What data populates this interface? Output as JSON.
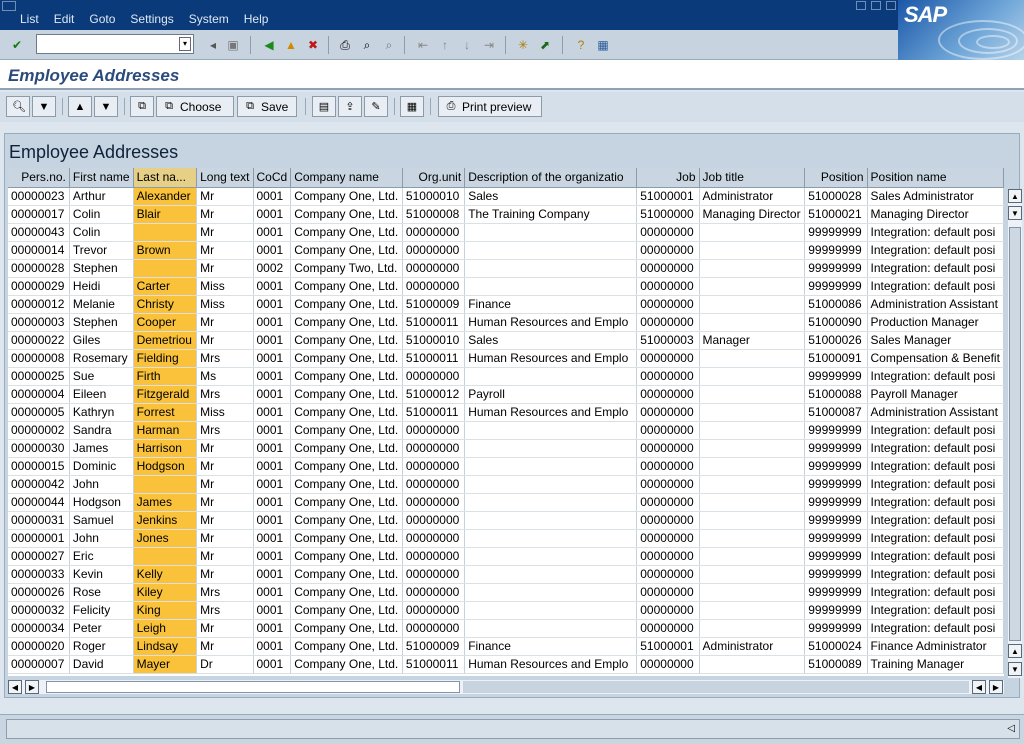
{
  "menu": {
    "items": [
      "List",
      "Edit",
      "Goto",
      "Settings",
      "System",
      "Help"
    ]
  },
  "logo_text": "SAP",
  "page_title": "Employee Addresses",
  "app_toolbar": {
    "choose_label": "Choose",
    "save_label": "Save",
    "print_preview_label": "Print preview"
  },
  "list_title": "Employee Addresses",
  "columns": [
    "Pers.no.",
    "First name",
    "Last na...",
    "Long text",
    "CoCd",
    "Company name",
    "Org.unit",
    "Description of the organizatio",
    "Job",
    "Job title",
    "Position",
    "Position name"
  ],
  "rows": [
    [
      "00000023",
      "Arthur",
      "Alexander",
      "Mr",
      "0001",
      "Company One, Ltd.",
      "51000010",
      "Sales",
      "51000001",
      "Administrator",
      "51000028",
      "Sales Administrator"
    ],
    [
      "00000017",
      "Colin",
      "Blair",
      "Mr",
      "0001",
      "Company One, Ltd.",
      "51000008",
      "The Training Company",
      "51000000",
      "Managing Director",
      "51000021",
      "Managing Director"
    ],
    [
      "00000043",
      "Colin",
      "",
      "Mr",
      "0001",
      "Company One, Ltd.",
      "00000000",
      "",
      "00000000",
      "",
      "99999999",
      "Integration: default posi"
    ],
    [
      "00000014",
      "Trevor",
      "Brown",
      "Mr",
      "0001",
      "Company One, Ltd.",
      "00000000",
      "",
      "00000000",
      "",
      "99999999",
      "Integration: default posi"
    ],
    [
      "00000028",
      "Stephen",
      "",
      "Mr",
      "0002",
      "Company Two, Ltd.",
      "00000000",
      "",
      "00000000",
      "",
      "99999999",
      "Integration: default posi"
    ],
    [
      "00000029",
      "Heidi",
      "Carter",
      "Miss",
      "0001",
      "Company One, Ltd.",
      "00000000",
      "",
      "00000000",
      "",
      "99999999",
      "Integration: default posi"
    ],
    [
      "00000012",
      "Melanie",
      "Christy",
      "Miss",
      "0001",
      "Company One, Ltd.",
      "51000009",
      "Finance",
      "00000000",
      "",
      "51000086",
      "Administration Assistant"
    ],
    [
      "00000003",
      "Stephen",
      "Cooper",
      "Mr",
      "0001",
      "Company One, Ltd.",
      "51000011",
      "Human Resources and Emplo",
      "00000000",
      "",
      "51000090",
      "Production Manager"
    ],
    [
      "00000022",
      "Giles",
      "Demetriou",
      "Mr",
      "0001",
      "Company One, Ltd.",
      "51000010",
      "Sales",
      "51000003",
      "Manager",
      "51000026",
      "Sales Manager"
    ],
    [
      "00000008",
      "Rosemary",
      "Fielding",
      "Mrs",
      "0001",
      "Company One, Ltd.",
      "51000011",
      "Human Resources and Emplo",
      "00000000",
      "",
      "51000091",
      "Compensation & Benefit"
    ],
    [
      "00000025",
      "Sue",
      "Firth",
      "Ms",
      "0001",
      "Company One, Ltd.",
      "00000000",
      "",
      "00000000",
      "",
      "99999999",
      "Integration: default posi"
    ],
    [
      "00000004",
      "Eileen",
      "Fitzgerald",
      "Mrs",
      "0001",
      "Company One, Ltd.",
      "51000012",
      "Payroll",
      "00000000",
      "",
      "51000088",
      "Payroll Manager"
    ],
    [
      "00000005",
      "Kathryn",
      "Forrest",
      "Miss",
      "0001",
      "Company One, Ltd.",
      "51000011",
      "Human Resources and Emplo",
      "00000000",
      "",
      "51000087",
      "Administration Assistant"
    ],
    [
      "00000002",
      "Sandra",
      "Harman",
      "Mrs",
      "0001",
      "Company One, Ltd.",
      "00000000",
      "",
      "00000000",
      "",
      "99999999",
      "Integration: default posi"
    ],
    [
      "00000030",
      "James",
      "Harrison",
      "Mr",
      "0001",
      "Company One, Ltd.",
      "00000000",
      "",
      "00000000",
      "",
      "99999999",
      "Integration: default posi"
    ],
    [
      "00000015",
      "Dominic",
      "Hodgson",
      "Mr",
      "0001",
      "Company One, Ltd.",
      "00000000",
      "",
      "00000000",
      "",
      "99999999",
      "Integration: default posi"
    ],
    [
      "00000042",
      "John",
      "",
      "Mr",
      "0001",
      "Company One, Ltd.",
      "00000000",
      "",
      "00000000",
      "",
      "99999999",
      "Integration: default posi"
    ],
    [
      "00000044",
      "Hodgson",
      "James",
      "Mr",
      "0001",
      "Company One, Ltd.",
      "00000000",
      "",
      "00000000",
      "",
      "99999999",
      "Integration: default posi"
    ],
    [
      "00000031",
      "Samuel",
      "Jenkins",
      "Mr",
      "0001",
      "Company One, Ltd.",
      "00000000",
      "",
      "00000000",
      "",
      "99999999",
      "Integration: default posi"
    ],
    [
      "00000001",
      "John",
      "Jones",
      "Mr",
      "0001",
      "Company One, Ltd.",
      "00000000",
      "",
      "00000000",
      "",
      "99999999",
      "Integration: default posi"
    ],
    [
      "00000027",
      "Eric",
      "",
      "Mr",
      "0001",
      "Company One, Ltd.",
      "00000000",
      "",
      "00000000",
      "",
      "99999999",
      "Integration: default posi"
    ],
    [
      "00000033",
      "Kevin",
      "Kelly",
      "Mr",
      "0001",
      "Company One, Ltd.",
      "00000000",
      "",
      "00000000",
      "",
      "99999999",
      "Integration: default posi"
    ],
    [
      "00000026",
      "Rose",
      "Kiley",
      "Mrs",
      "0001",
      "Company One, Ltd.",
      "00000000",
      "",
      "00000000",
      "",
      "99999999",
      "Integration: default posi"
    ],
    [
      "00000032",
      "Felicity",
      "King",
      "Mrs",
      "0001",
      "Company One, Ltd.",
      "00000000",
      "",
      "00000000",
      "",
      "99999999",
      "Integration: default posi"
    ],
    [
      "00000034",
      "Peter",
      "Leigh",
      "Mr",
      "0001",
      "Company One, Ltd.",
      "00000000",
      "",
      "00000000",
      "",
      "99999999",
      "Integration: default posi"
    ],
    [
      "00000020",
      "Roger",
      "Lindsay",
      "Mr",
      "0001",
      "Company One, Ltd.",
      "51000009",
      "Finance",
      "51000001",
      "Administrator",
      "51000024",
      "Finance Administrator"
    ],
    [
      "00000007",
      "David",
      "Mayer",
      "Dr",
      "0001",
      "Company One, Ltd.",
      "51000011",
      "Human Resources and Emplo",
      "00000000",
      "",
      "51000089",
      "Training Manager"
    ]
  ],
  "colors": {
    "menubar": "#0a3a7a",
    "selected_column": "#f9c23a",
    "panel": "#c6d4e1"
  }
}
